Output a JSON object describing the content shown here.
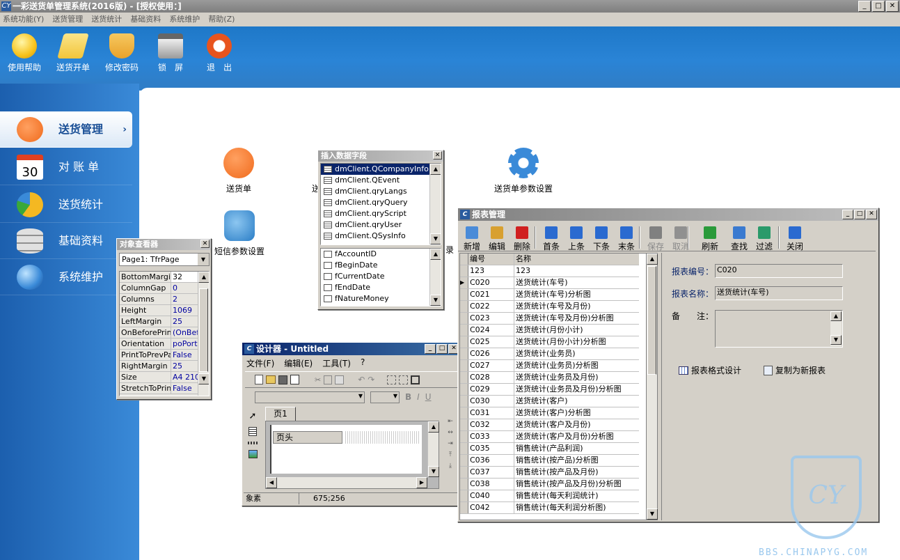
{
  "app": {
    "title": "一彩送货单管理系统(2016版) - [授权使用：]",
    "logo": "CY",
    "watermark": "BBS.CHINAPYG.COM"
  },
  "menu": [
    "系统功能(Y)",
    "送货管理",
    "送货统计",
    "基础资料",
    "系统维护",
    "帮助(Z)"
  ],
  "toolbar": [
    {
      "label": "使用帮助",
      "icon": "lightbulb-icon",
      "color": "#f7c21a"
    },
    {
      "label": "送货开单",
      "icon": "tag-icon",
      "color": "#f2c53a"
    },
    {
      "label": "修改密码",
      "icon": "shield-icon",
      "color": "#e9a22a"
    },
    {
      "label": "锁　屏",
      "icon": "lock-icon",
      "color": "#d8d8d8"
    },
    {
      "label": "退　出",
      "icon": "exit-icon",
      "color": "#e8541e"
    }
  ],
  "sidebar": [
    {
      "label": "送货管理",
      "icon": "rss-icon",
      "color": "#f06a1c",
      "chev": "›"
    },
    {
      "label": "对 账 单",
      "icon": "calendar-icon",
      "color": "#ffffff",
      "text": "30"
    },
    {
      "label": "送货统计",
      "icon": "pie-chart-icon",
      "color": "#f4b822"
    },
    {
      "label": "基础资料",
      "icon": "database-icon",
      "color": "#c8c8c8"
    },
    {
      "label": "系统维护",
      "icon": "globe-icon",
      "color": "#3a8ad8"
    }
  ],
  "desktop": [
    {
      "label": "送货单",
      "icon": "rss-icon",
      "color": "#f06a1c"
    },
    {
      "label": "短信参数设置",
      "icon": "gears-icon",
      "color": "#2a7dc6"
    },
    {
      "label": "送货单参数设置",
      "icon": "gear-icon",
      "color": "#3a8ad8"
    },
    {
      "label": "送",
      "partial": true
    },
    {
      "label": "录",
      "partial": true
    }
  ],
  "insert_field": {
    "title": "插入数据字段",
    "close": "✕",
    "datasets": [
      "dmClient.QCompanyInfo",
      "dmClient.QEvent",
      "dmClient.qryLangs",
      "dmClient.qryQuery",
      "dmClient.qryScript",
      "dmClient.qryUser",
      "dmClient.QSysInfo"
    ],
    "fields": [
      "fAccountID",
      "fBeginDate",
      "fCurrentDate",
      "fEndDate",
      "fNatureMoney"
    ]
  },
  "inspector": {
    "title": "对象查看器",
    "close": "✕",
    "selected": "Page1: TfrPage",
    "props": [
      [
        "BottomMargin",
        "32"
      ],
      [
        "ColumnGap",
        "0"
      ],
      [
        "Columns",
        "2"
      ],
      [
        "Height",
        "1069"
      ],
      [
        "LeftMargin",
        "25"
      ],
      [
        "OnBeforePrint",
        "(OnBefo"
      ],
      [
        "Orientation",
        "poPortr"
      ],
      [
        "PrintToPrevPa",
        "False"
      ],
      [
        "RightMargin",
        "25"
      ],
      [
        "Size",
        "A4 210"
      ],
      [
        "StretchToPrint",
        "False"
      ]
    ]
  },
  "designer": {
    "title": "设计器 - Untitled",
    "menu": [
      "文件(F)",
      "编辑(E)",
      "工具(T)",
      "?"
    ],
    "tab": "页1",
    "band": "页头",
    "status_left": "象素",
    "status_right": "675;256",
    "format_btns": [
      "B",
      "I",
      "U"
    ]
  },
  "report": {
    "title": "报表管理",
    "tools": [
      {
        "label": "新增",
        "color": "#4a8bd8"
      },
      {
        "label": "编辑",
        "color": "#d8a030"
      },
      {
        "label": "删除",
        "color": "#d02020"
      },
      {
        "label": "首条",
        "color": "#2a6ad0"
      },
      {
        "label": "上条",
        "color": "#2a6ad0"
      },
      {
        "label": "下条",
        "color": "#2a6ad0"
      },
      {
        "label": "末条",
        "color": "#2a6ad0"
      },
      {
        "label": "保存",
        "color": "#808080",
        "disabled": true
      },
      {
        "label": "取消",
        "color": "#909090",
        "disabled": true
      },
      {
        "label": "刷新",
        "color": "#2a9a3a"
      },
      {
        "label": "查找",
        "color": "#3a7ad0"
      },
      {
        "label": "过滤",
        "color": "#2a9a6a"
      },
      {
        "label": "关闭",
        "color": "#2a6ad0"
      }
    ],
    "columns": [
      "编号",
      "名称"
    ],
    "rows": [
      [
        "123",
        "123"
      ],
      [
        "C020",
        "送货统计(车号)"
      ],
      [
        "C021",
        "送货统计(车号)分析图"
      ],
      [
        "C022",
        "送货统计(车号及月份)"
      ],
      [
        "C023",
        "送货统计(车号及月份)分析图"
      ],
      [
        "C024",
        "送货统计(月份小计)"
      ],
      [
        "C025",
        "送货统计(月份小计)分析图"
      ],
      [
        "C026",
        "送货统计(业务员)"
      ],
      [
        "C027",
        "送货统计(业务员)分析图"
      ],
      [
        "C028",
        "送货统计(业务员及月份)"
      ],
      [
        "C029",
        "送货统计(业务员及月份)分析图"
      ],
      [
        "C030",
        "送货统计(客户)"
      ],
      [
        "C031",
        "送货统计(客户)分析图"
      ],
      [
        "C032",
        "送货统计(客户及月份)"
      ],
      [
        "C033",
        "送货统计(客户及月份)分析图"
      ],
      [
        "C035",
        "销售统计(产品利润)"
      ],
      [
        "C036",
        "销售统计(按产品)分析图"
      ],
      [
        "C037",
        "销售统计(按产品及月份)"
      ],
      [
        "C038",
        "销售统计(按产品及月份)分析图"
      ],
      [
        "C040",
        "销售统计(每天利润统计)"
      ],
      [
        "C042",
        "销售统计(每天利润分析图)"
      ]
    ],
    "current_row": 1,
    "detail": {
      "code_label": "报表编号：",
      "code": "C020",
      "name_label": "报表名称：",
      "name": "送货统计(车号)",
      "note_label": "备　　注：",
      "note": "",
      "design_btn": "报表格式设计",
      "copy_btn": "复制为新报表"
    }
  }
}
